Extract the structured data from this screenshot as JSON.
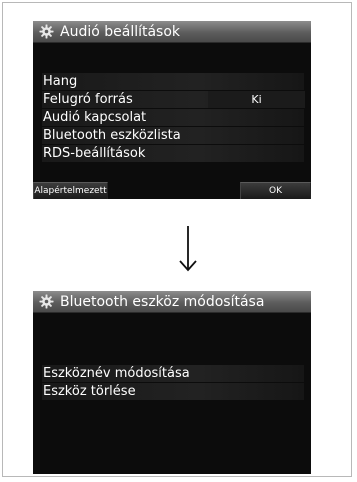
{
  "screen1": {
    "title": "Audió beállítások",
    "title_icon": "gear-icon",
    "items": [
      {
        "label": "Hang",
        "value": ""
      },
      {
        "label": "Felugró forrás",
        "value": "Ki"
      },
      {
        "label": "Audió kapcsolat",
        "value": ""
      },
      {
        "label": "Bluetooth eszközlista",
        "value": ""
      },
      {
        "label": "RDS-beállítások",
        "value": ""
      }
    ],
    "buttons": {
      "default_label": "Alapértelmezett",
      "ok_label": "OK"
    }
  },
  "arrow_icon": "down-arrow-icon",
  "screen2": {
    "title": "Bluetooth eszköz módosítása",
    "title_icon": "gear-icon",
    "items": [
      {
        "label": "Eszköznév módosítása"
      },
      {
        "label": "Eszköz törlése"
      }
    ]
  },
  "colors": {
    "screen_bg": "#0c0c0c",
    "titlebar": "#6a6a6a",
    "text": "#ffffff"
  }
}
